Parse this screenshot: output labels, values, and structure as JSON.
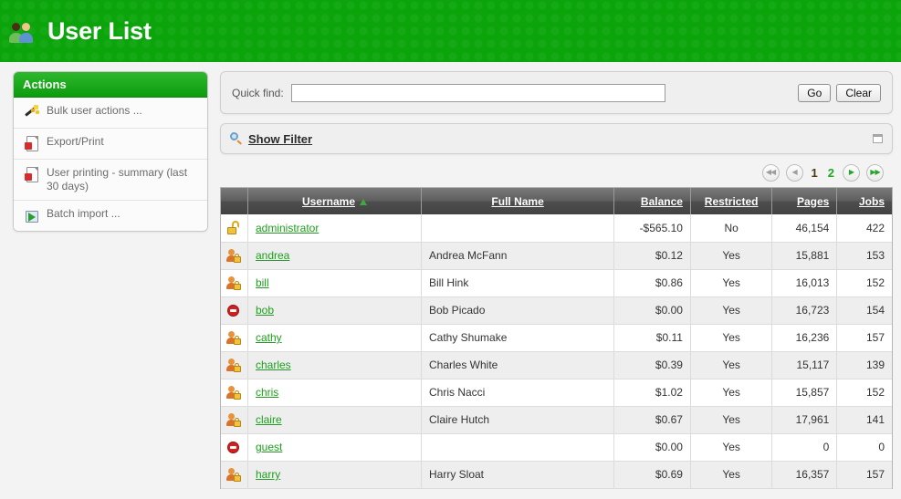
{
  "header": {
    "title": "User List",
    "icon": "users-icon"
  },
  "sidebar": {
    "title": "Actions",
    "items": [
      {
        "label": "Bulk user actions ...",
        "icon": "magic-wand-icon"
      },
      {
        "label": "Export/Print",
        "icon": "pdf-icon"
      },
      {
        "label": "User printing - summary (last 30 days)",
        "icon": "pdf-icon"
      },
      {
        "label": "Batch import ...",
        "icon": "import-icon"
      }
    ]
  },
  "quickfind": {
    "label": "Quick find:",
    "value": "",
    "placeholder": "",
    "go_label": "Go",
    "clear_label": "Clear"
  },
  "filter": {
    "label": "Show Filter",
    "icon": "magnifier-icon",
    "collapse_icon": "collapse-icon"
  },
  "pagination": {
    "first": "◀◀",
    "prev": "◀",
    "next": "▶",
    "last": "▶▶",
    "pages": [
      {
        "label": "1",
        "current": true
      },
      {
        "label": "2",
        "current": false
      }
    ]
  },
  "table": {
    "columns": [
      {
        "key": "icon",
        "label": "",
        "sortable": false
      },
      {
        "key": "username",
        "label": "Username",
        "sorted": "asc"
      },
      {
        "key": "fullname",
        "label": "Full Name"
      },
      {
        "key": "balance",
        "label": "Balance"
      },
      {
        "key": "restricted",
        "label": "Restricted"
      },
      {
        "key": "pages",
        "label": "Pages"
      },
      {
        "key": "jobs",
        "label": "Jobs"
      }
    ],
    "rows": [
      {
        "icon": "padlock-open-icon",
        "username": "administrator",
        "fullname": "",
        "balance": "-$565.10",
        "balance_negative": true,
        "restricted": "No",
        "pages": "46,154",
        "jobs": "422"
      },
      {
        "icon": "user-lock-icon",
        "username": "andrea",
        "fullname": "Andrea McFann",
        "balance": "$0.12",
        "balance_negative": false,
        "restricted": "Yes",
        "pages": "15,881",
        "jobs": "153"
      },
      {
        "icon": "user-lock-icon",
        "username": "bill",
        "fullname": "Bill Hink",
        "balance": "$0.86",
        "balance_negative": false,
        "restricted": "Yes",
        "pages": "16,013",
        "jobs": "152"
      },
      {
        "icon": "no-entry-icon",
        "username": "bob",
        "fullname": "Bob Picado",
        "balance": "$0.00",
        "balance_negative": false,
        "restricted": "Yes",
        "pages": "16,723",
        "jobs": "154"
      },
      {
        "icon": "user-lock-icon",
        "username": "cathy",
        "fullname": "Cathy Shumake",
        "balance": "$0.11",
        "balance_negative": false,
        "restricted": "Yes",
        "pages": "16,236",
        "jobs": "157"
      },
      {
        "icon": "user-lock-icon",
        "username": "charles",
        "fullname": "Charles White",
        "balance": "$0.39",
        "balance_negative": false,
        "restricted": "Yes",
        "pages": "15,117",
        "jobs": "139"
      },
      {
        "icon": "user-lock-icon",
        "username": "chris",
        "fullname": "Chris Nacci",
        "balance": "$1.02",
        "balance_negative": false,
        "restricted": "Yes",
        "pages": "15,857",
        "jobs": "152"
      },
      {
        "icon": "user-lock-icon",
        "username": "claire",
        "fullname": "Claire Hutch",
        "balance": "$0.67",
        "balance_negative": false,
        "restricted": "Yes",
        "pages": "17,961",
        "jobs": "141"
      },
      {
        "icon": "no-entry-icon",
        "username": "guest",
        "fullname": "",
        "balance": "$0.00",
        "balance_negative": false,
        "restricted": "Yes",
        "pages": "0",
        "jobs": "0"
      },
      {
        "icon": "user-lock-icon",
        "username": "harry",
        "fullname": "Harry Sloat",
        "balance": "$0.69",
        "balance_negative": false,
        "restricted": "Yes",
        "pages": "16,357",
        "jobs": "157"
      }
    ]
  },
  "colors": {
    "brand_green": "#0ba50b",
    "link_green": "#1f9e1f",
    "negative_red": "#e01b1b",
    "header_gray": "#5d5d5d"
  }
}
